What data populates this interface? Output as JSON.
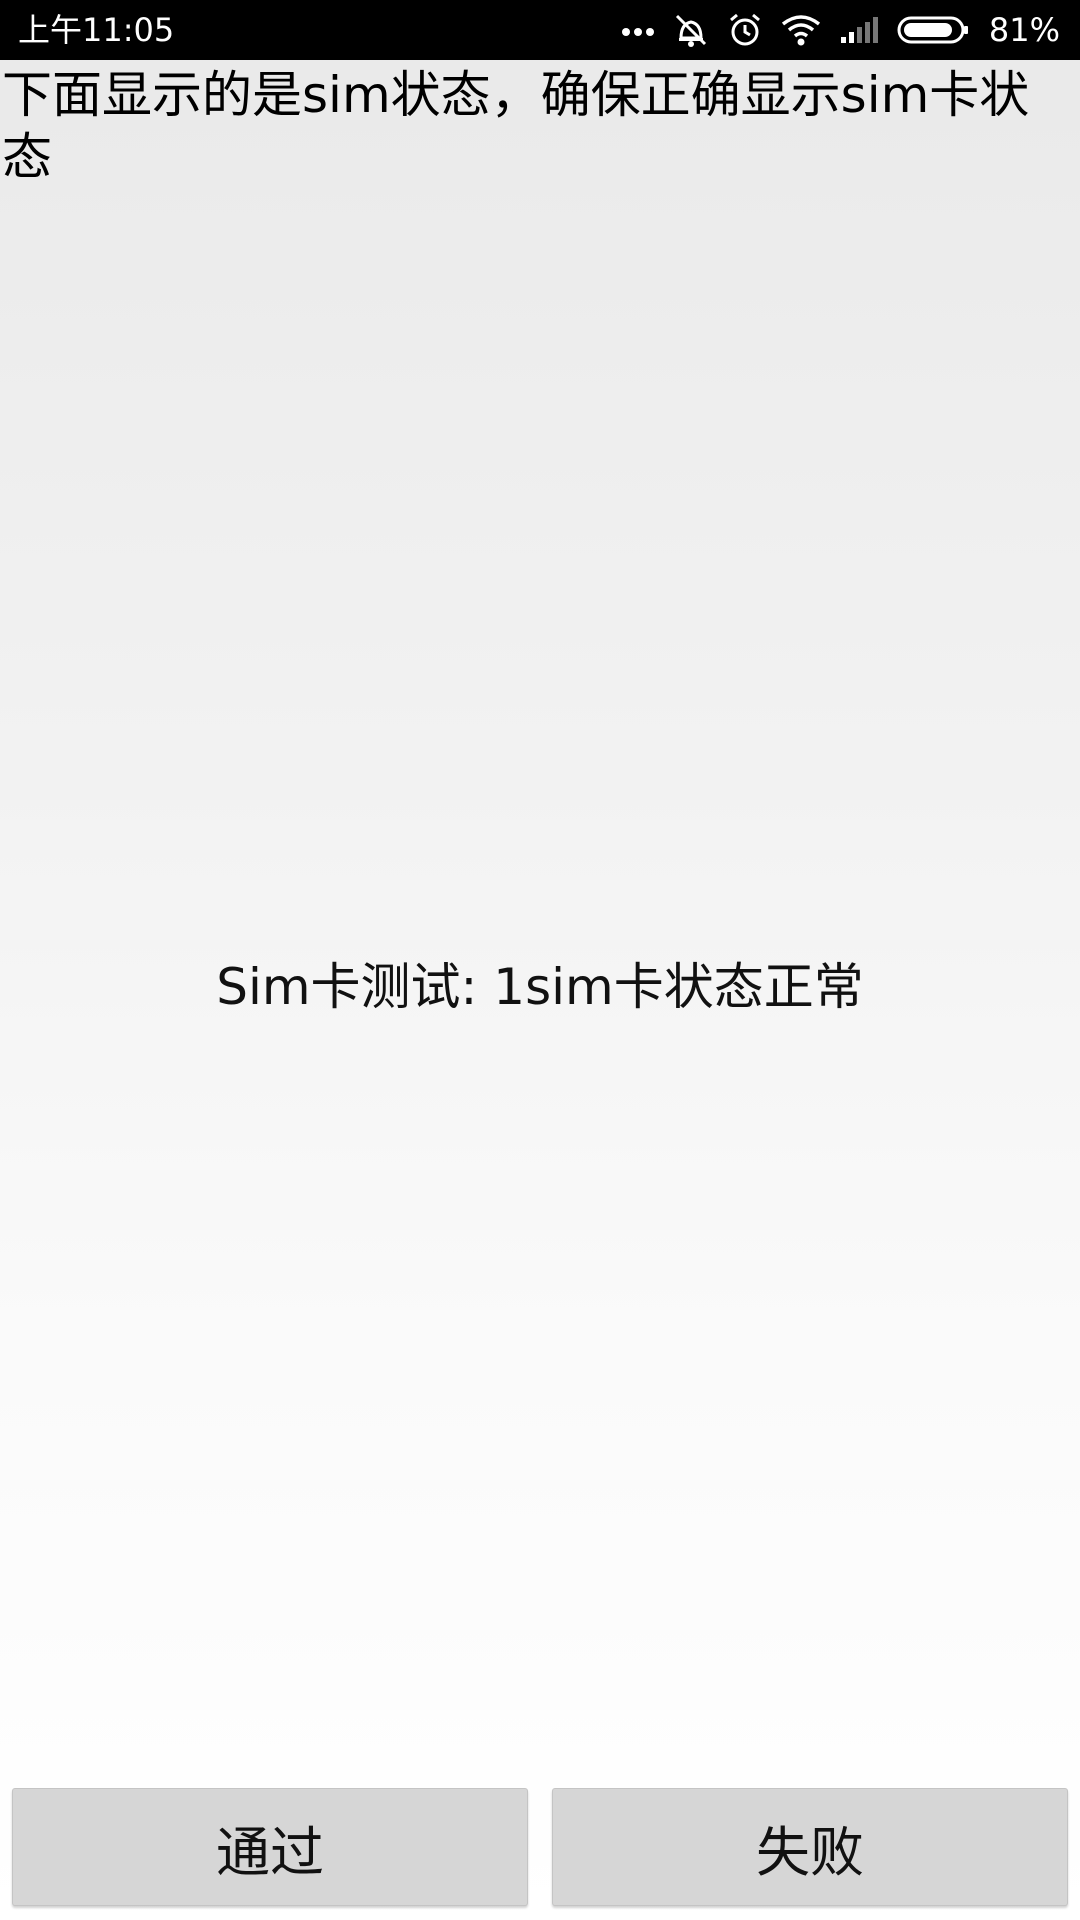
{
  "status_bar": {
    "time": "上午11:05",
    "icons": [
      "more-dots-icon",
      "vibrate-icon",
      "alarm-icon",
      "wifi-icon",
      "signal-icon",
      "battery-icon"
    ],
    "battery_percent": "81%"
  },
  "instruction": {
    "text": "下面显示的是sim状态，确保正确显示sim卡状态"
  },
  "sim_status": {
    "text": "Sim卡测试: 1sim卡状态正常"
  },
  "buttons": {
    "pass_label": "通过",
    "fail_label": "失败"
  },
  "colors": {
    "status_bar_bg": "#000000",
    "button_bg": "#d6d6d6",
    "text": "#000000"
  }
}
